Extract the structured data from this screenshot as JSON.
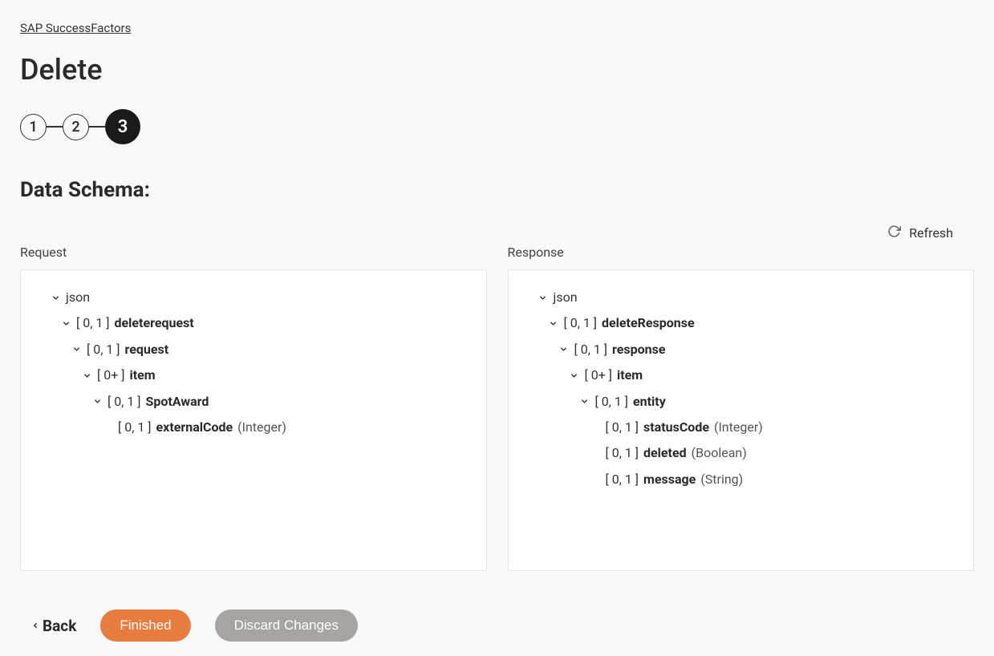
{
  "breadcrumb": "SAP SuccessFactors",
  "page_title": "Delete",
  "stepper": {
    "steps": [
      "1",
      "2",
      "3"
    ],
    "active_index": 2
  },
  "section_heading": "Data Schema:",
  "refresh_label": "Refresh",
  "panels": {
    "request": {
      "label": "Request",
      "root": "json",
      "tree": [
        {
          "indent": 1,
          "chevron": true,
          "card": "[ 0, 1 ]",
          "name": "deleterequest",
          "type": ""
        },
        {
          "indent": 2,
          "chevron": true,
          "card": "[ 0, 1 ]",
          "name": "request",
          "type": ""
        },
        {
          "indent": 3,
          "chevron": true,
          "card": "[ 0+ ]",
          "name": "item",
          "type": ""
        },
        {
          "indent": 4,
          "chevron": true,
          "card": "[ 0, 1 ]",
          "name": "SpotAward",
          "type": ""
        },
        {
          "indent": 5,
          "chevron": false,
          "card": "[ 0, 1 ]",
          "name": "externalCode",
          "type": "(Integer)"
        }
      ]
    },
    "response": {
      "label": "Response",
      "root": "json",
      "tree": [
        {
          "indent": 1,
          "chevron": true,
          "card": "[ 0, 1 ]",
          "name": "deleteResponse",
          "type": ""
        },
        {
          "indent": 2,
          "chevron": true,
          "card": "[ 0, 1 ]",
          "name": "response",
          "type": ""
        },
        {
          "indent": 3,
          "chevron": true,
          "card": "[ 0+ ]",
          "name": "item",
          "type": ""
        },
        {
          "indent": 4,
          "chevron": true,
          "card": "[ 0, 1 ]",
          "name": "entity",
          "type": ""
        },
        {
          "indent": 5,
          "chevron": false,
          "card": "[ 0, 1 ]",
          "name": "statusCode",
          "type": "(Integer)"
        },
        {
          "indent": 5,
          "chevron": false,
          "card": "[ 0, 1 ]",
          "name": "deleted",
          "type": "(Boolean)"
        },
        {
          "indent": 5,
          "chevron": false,
          "card": "[ 0, 1 ]",
          "name": "message",
          "type": "(String)"
        }
      ]
    }
  },
  "footer": {
    "back": "Back",
    "finished": "Finished",
    "discard": "Discard Changes"
  }
}
